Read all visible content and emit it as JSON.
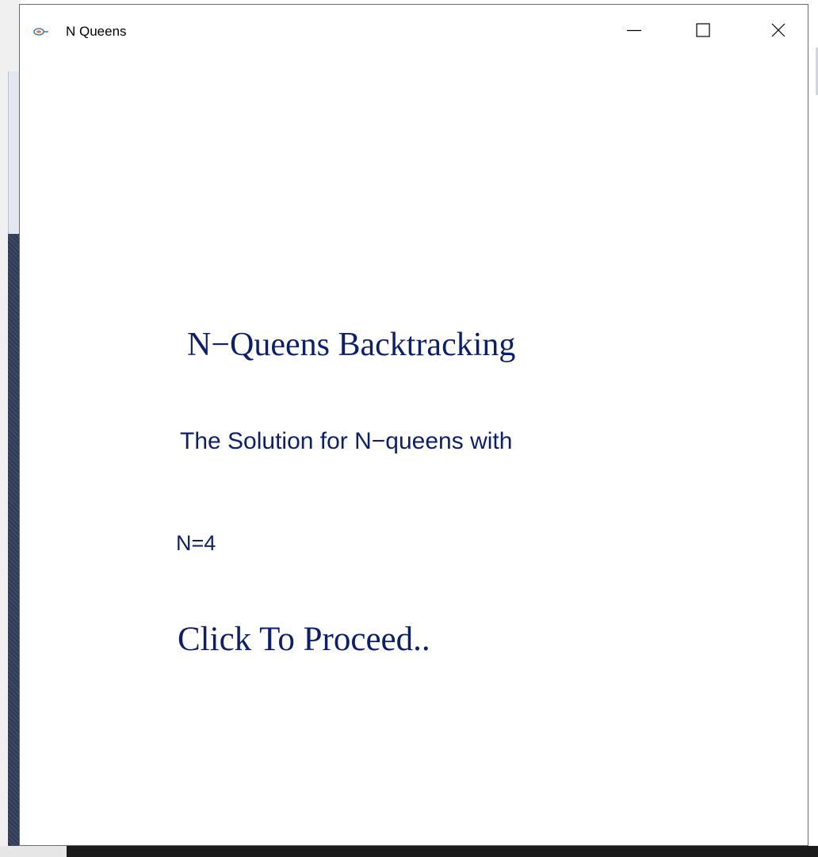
{
  "window": {
    "title": "N Queens",
    "icon": "java-coffee-icon",
    "controls": {
      "minimize_icon": "minimize-icon",
      "maximize_icon": "maximize-icon",
      "close_icon": "close-icon"
    }
  },
  "content": {
    "heading": "N−Queens Backtracking",
    "solution_text": "The Solution for N−queens with",
    "n_value": "N=4",
    "proceed_label": "Click To Proceed.."
  },
  "colors": {
    "text": "#0b1f6e",
    "window_bg": "#ffffff",
    "window_border": "#6b6b6b"
  }
}
